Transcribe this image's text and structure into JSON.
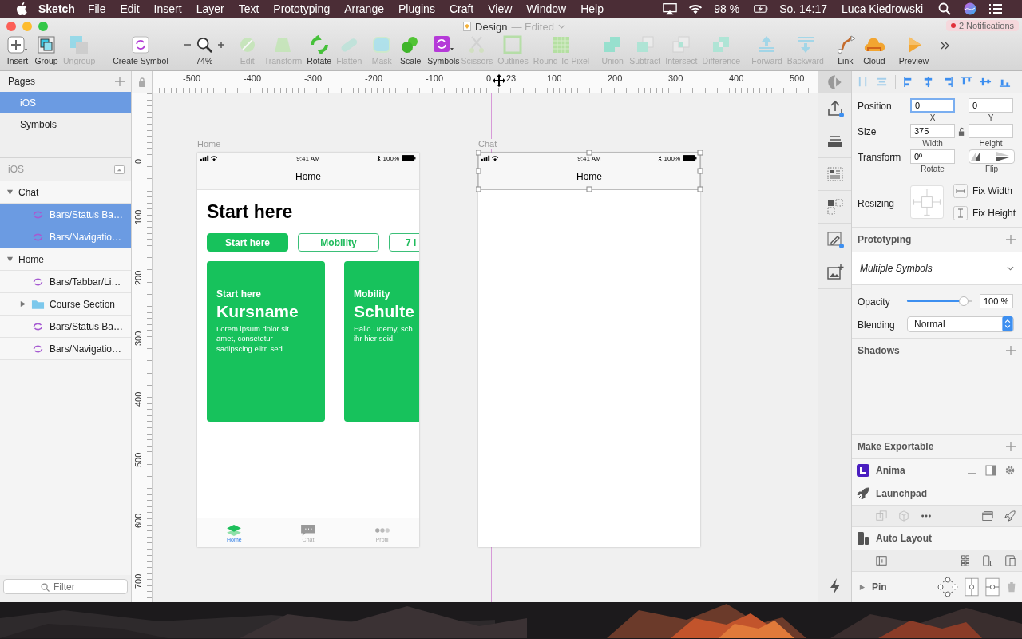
{
  "menubar": {
    "app": "Sketch",
    "menus": [
      "File",
      "Edit",
      "Insert",
      "Layer",
      "Text",
      "Prototyping",
      "Arrange",
      "Plugins",
      "Craft",
      "View",
      "Window",
      "Help"
    ],
    "battery": "98 %",
    "clock": "So. 14:17",
    "user": "Luca Kiedrowski"
  },
  "window": {
    "title": "Design",
    "status": "— Edited",
    "notifications": "2 Notifications"
  },
  "toolbar": {
    "zoom": {
      "label": "74%"
    },
    "items": [
      {
        "label": "Insert",
        "disabled": false
      },
      {
        "label": "Group",
        "disabled": false
      },
      {
        "label": "Ungroup",
        "disabled": true
      },
      {
        "label": "Create Symbol",
        "disabled": false
      },
      {
        "label": "Edit",
        "disabled": true
      },
      {
        "label": "Transform",
        "disabled": true
      },
      {
        "label": "Rotate",
        "disabled": false
      },
      {
        "label": "Flatten",
        "disabled": true
      },
      {
        "label": "Mask",
        "disabled": true
      },
      {
        "label": "Scale",
        "disabled": false
      },
      {
        "label": "Symbols",
        "disabled": false
      },
      {
        "label": "Scissors",
        "disabled": true
      },
      {
        "label": "Outlines",
        "disabled": true
      },
      {
        "label": "Round To Pixel",
        "disabled": true
      },
      {
        "label": "Union",
        "disabled": true
      },
      {
        "label": "Subtract",
        "disabled": true
      },
      {
        "label": "Intersect",
        "disabled": true
      },
      {
        "label": "Difference",
        "disabled": true
      },
      {
        "label": "Forward",
        "disabled": true
      },
      {
        "label": "Backward",
        "disabled": true
      },
      {
        "label": "Link",
        "disabled": false
      },
      {
        "label": "Cloud",
        "disabled": false
      },
      {
        "label": "Preview",
        "disabled": false
      }
    ]
  },
  "pages": {
    "title": "Pages",
    "items": [
      {
        "label": "iOS",
        "selected": true
      },
      {
        "label": "Symbols",
        "selected": false
      }
    ]
  },
  "layers": {
    "title": "iOS",
    "items": [
      {
        "label": "Chat",
        "expanded": true,
        "selected": false,
        "children": [
          {
            "label": "Bars/Status Ba…",
            "kind": "symbol",
            "selected": true
          },
          {
            "label": "Bars/Navigatio…",
            "kind": "symbol",
            "selected": true
          }
        ]
      },
      {
        "label": "Home",
        "expanded": true,
        "selected": false,
        "children": [
          {
            "label": "Bars/Tabbar/Li…",
            "kind": "symbol",
            "selected": false
          },
          {
            "label": "Course Section",
            "kind": "folder",
            "expanded": false,
            "selected": false
          },
          {
            "label": "Bars/Status Ba…",
            "kind": "symbol",
            "selected": false
          },
          {
            "label": "Bars/Navigatio…",
            "kind": "symbol",
            "selected": false
          }
        ]
      }
    ],
    "filter": {
      "placeholder": "Filter"
    }
  },
  "canvas": {
    "ruler": {
      "h_labels": [
        "-500",
        "-400",
        "-300",
        "-200",
        "-100",
        "0",
        "100",
        "200",
        "300",
        "400",
        "500"
      ],
      "cursor_reading": "23",
      "v_labels": [
        "0",
        "100",
        "200",
        "300",
        "400",
        "500",
        "600",
        "700"
      ]
    },
    "artboards": [
      {
        "name": "Home",
        "kind": "home",
        "selected": false,
        "time": "9:41 AM",
        "battery": "100%",
        "nav_title": "Home",
        "heading": "Start here",
        "chips": [
          {
            "label": "Start here",
            "selected": true
          },
          {
            "label": "Mobility",
            "selected": false
          },
          {
            "label": "7 l",
            "selected": false
          }
        ],
        "cards": [
          {
            "eyebrow": "Start here",
            "title": "Kursname",
            "body": "Lorem ipsum dolor sit\namet, consetetur\nsadipscing elitr, sed..."
          },
          {
            "eyebrow": "Mobility",
            "title": "Schulte",
            "body": "Hallo Udemy, sch\nihr hier seid."
          }
        ],
        "tabs": [
          {
            "label": "Home",
            "selected": true
          },
          {
            "label": "Chat",
            "selected": false
          },
          {
            "label": "Profil",
            "selected": false
          }
        ]
      },
      {
        "name": "Chat",
        "kind": "chat",
        "selected": true,
        "time": "9:41 AM",
        "battery": "100%",
        "nav_title": "Home"
      }
    ]
  },
  "inspector": {
    "position": {
      "label": "Position",
      "x": {
        "value": "0",
        "caption": "X",
        "focused": true
      },
      "y": {
        "value": "0",
        "caption": "Y",
        "focused": false
      }
    },
    "size": {
      "label": "Size",
      "width": {
        "value": "375",
        "caption": "Width"
      },
      "height": {
        "caption": "Height"
      }
    },
    "transform": {
      "label": "Transform",
      "rotate": {
        "value": "0º",
        "caption": "Rotate"
      },
      "flip_caption": "Flip"
    },
    "resizing": {
      "label": "Resizing",
      "options": [
        "Fix Width",
        "Fix Height"
      ]
    },
    "prototyping": {
      "title": "Prototyping",
      "dropdown": "Multiple Symbols"
    },
    "opacity": {
      "label": "Opacity",
      "level": 0.93,
      "value": "100 %"
    },
    "blending": {
      "label": "Blending",
      "value": "Normal"
    },
    "shadows": {
      "title": "Shadows"
    },
    "exportable": {
      "title": "Make Exportable"
    },
    "plugins": [
      {
        "name": "Anima"
      },
      {
        "name": "Launchpad"
      },
      {
        "name": "Auto Layout"
      }
    ],
    "pin": {
      "label": "Pin",
      "expanded": false
    }
  }
}
